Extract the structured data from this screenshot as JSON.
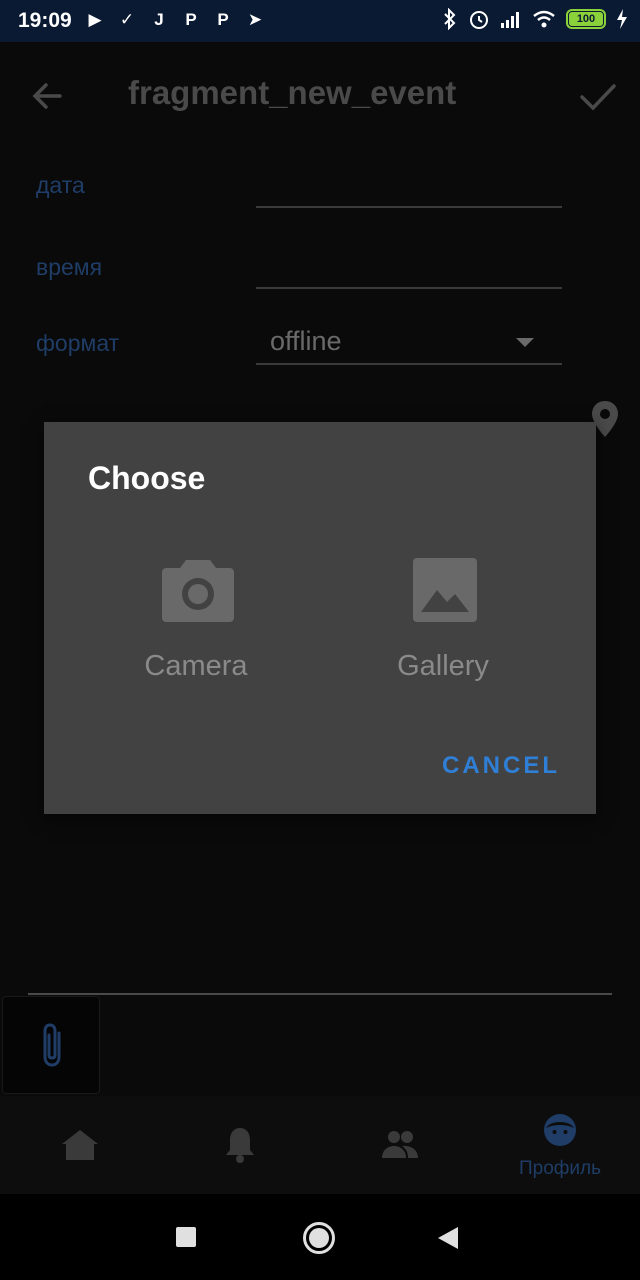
{
  "status_bar": {
    "time": "19:09",
    "battery": "100",
    "app_icons": [
      "▶",
      "✓",
      "J",
      "P",
      "P",
      "➤"
    ]
  },
  "toolbar": {
    "title": "fragment_new_event"
  },
  "form": {
    "date_label": "дата",
    "time_label": "время",
    "format_label": "формат",
    "format_value": "offline"
  },
  "dialog": {
    "title": "Choose",
    "camera_label": "Camera",
    "gallery_label": "Gallery",
    "cancel_label": "CANCEL"
  },
  "bottom_nav": {
    "profile_label": "Профиль"
  },
  "colors": {
    "accent": "#2f7fd6",
    "dialog_bg": "#424242",
    "dim_label": "#1f3d66"
  }
}
